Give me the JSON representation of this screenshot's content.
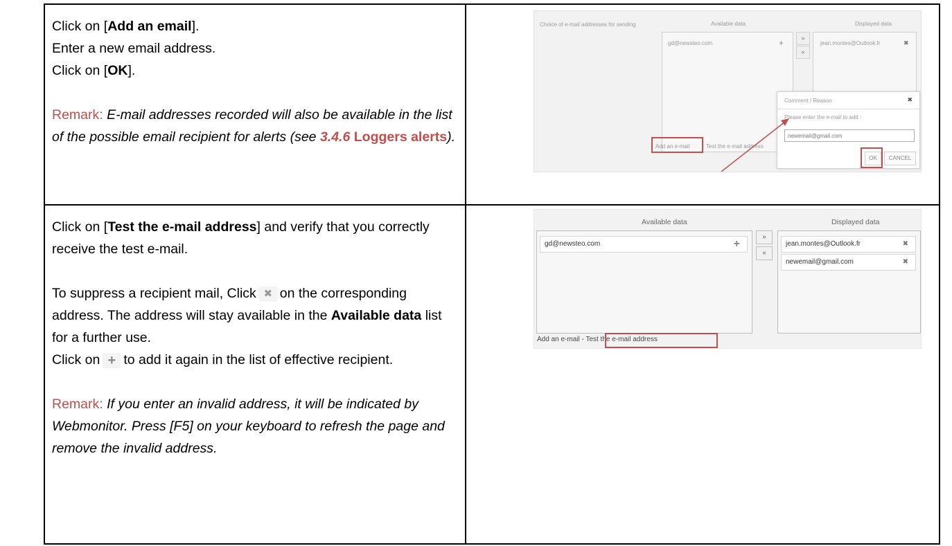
{
  "row1": {
    "line1": {
      "pre": "Click on [",
      "bold": "Add an email",
      "post": "]."
    },
    "line2": "Enter a new email address.",
    "line3": {
      "pre": "Click on [",
      "bold": "OK",
      "post": "]."
    },
    "remark_label": "Remark:",
    "remark_text": "E-mail addresses recorded will also be available in the list of the possible email recipient for alerts (see",
    "remark_ref_num": "3.4.6",
    "remark_ref_title": "Loggers alerts",
    "remark_end": ")."
  },
  "row2": {
    "p1": {
      "pre": "Click on [",
      "bold": "Test the e-mail address",
      "post": "] and verify that you correctly receive the test e-mail."
    },
    "p2": {
      "pre": "To suppress a recipient mail, Click",
      "post": "on the corresponding address. The address will stay available in the",
      "bold": "Available data",
      "post2": "list for a further use."
    },
    "p3": {
      "pre": "Click on",
      "post": "to add it again in the list of effective recipient."
    },
    "remark_label": "Remark:",
    "remark_text": "If you enter an invalid address, it will be indicated by Webmonitor. Press [F5] on your keyboard to refresh the page and remove the invalid address."
  },
  "shot1": {
    "label": "Choice of e-mail addresses for sending",
    "available_head": "Available data",
    "displayed_head": "Displayed data",
    "available_item": "gd@newsteo.com",
    "displayed_item": "jean.montes@Outlook.fr",
    "dialog_title": "Comment / Reason",
    "dialog_prompt": "Please enter the e-mail to add :",
    "dialog_input": "newemail@gmail.com",
    "ok": "OK",
    "cancel": "CANCEL",
    "add_link": "Add an e-mail",
    "test_link": "Test the e-mail address"
  },
  "shot2": {
    "available_head": "Available data",
    "displayed_head": "Displayed data",
    "available_items": [
      "gd@newsteo.com"
    ],
    "displayed_items": [
      "jean.montes@Outlook.fr",
      "newemail@gmail.com"
    ],
    "add_link": "Add an e-mail",
    "sep": "-",
    "test_link": "Test the e-mail address"
  },
  "icons": {
    "add": "plus-icon",
    "remove": "cross-icon",
    "move_right": "double-right-arrow-icon",
    "move_left": "double-left-arrow-icon"
  },
  "colors": {
    "remark": "#c0504d",
    "highlight_box": "#c0504d"
  }
}
